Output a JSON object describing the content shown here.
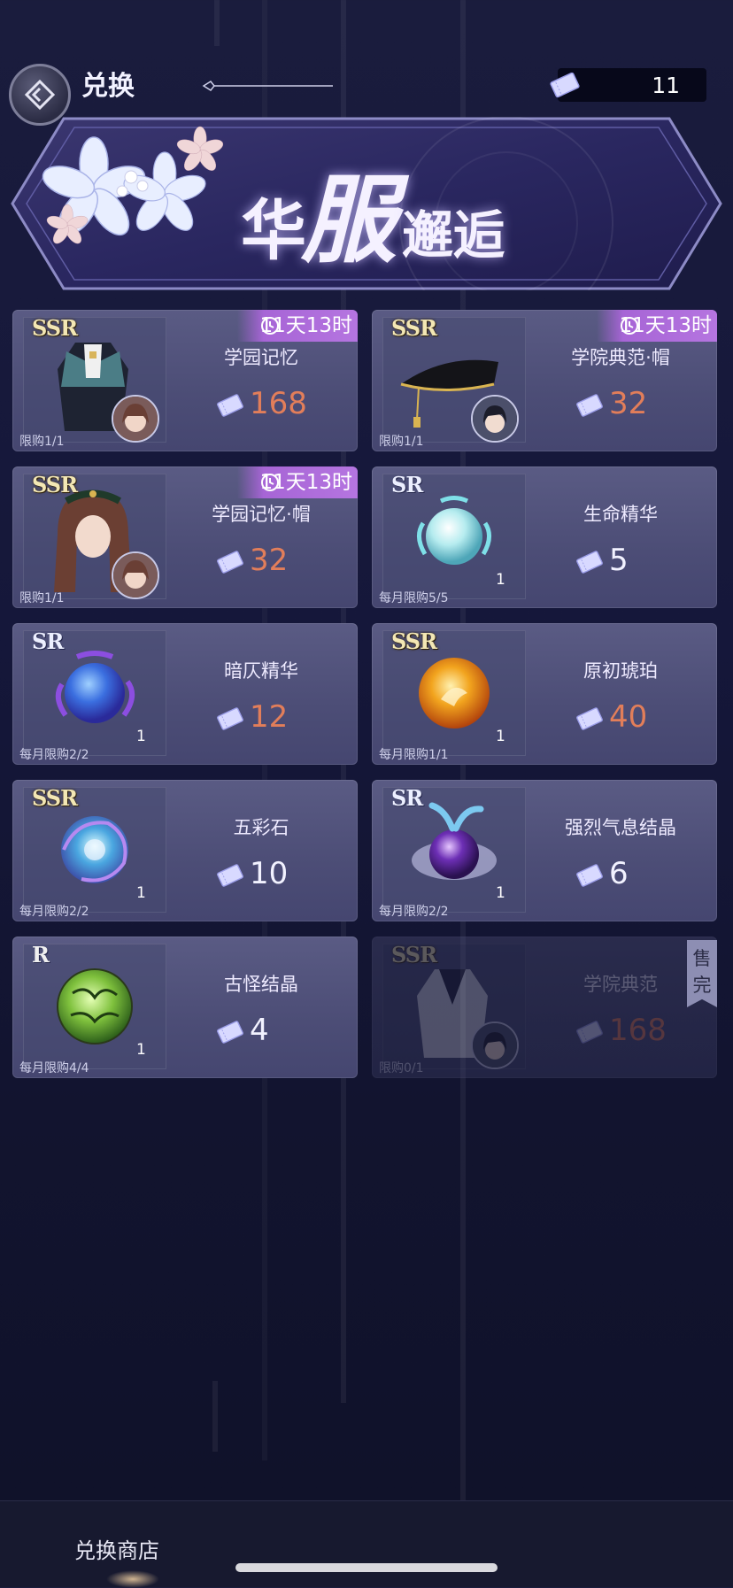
{
  "header": {
    "title": "兑换",
    "currency_amount": "11"
  },
  "banner": {
    "title_1": "华",
    "title_2": "服",
    "title_3": "邂逅"
  },
  "items": [
    {
      "rarity": "SSR",
      "name": "学园记忆",
      "price": "168",
      "limit": "限购1/1",
      "timer": "11天13时",
      "icon": "outfit-icon"
    },
    {
      "rarity": "SSR",
      "name": "学院典范·帽",
      "price": "32",
      "limit": "限购1/1",
      "timer": "11天13时",
      "icon": "hat-icon"
    },
    {
      "rarity": "SSR",
      "name": "学园记忆·帽",
      "price": "32",
      "limit": "限购1/1",
      "timer": "11天13时",
      "icon": "hairpiece-icon"
    },
    {
      "rarity": "SR",
      "name": "生命精华",
      "price": "5",
      "limit": "每月限购5/5",
      "qty": "1",
      "icon": "life-essence-orb-icon"
    },
    {
      "rarity": "SR",
      "name": "暗仄精华",
      "price": "12",
      "limit": "每月限购2/2",
      "qty": "1",
      "icon": "dark-essence-orb-icon"
    },
    {
      "rarity": "SSR",
      "name": "原初琥珀",
      "price": "40",
      "limit": "每月限购1/1",
      "qty": "1",
      "icon": "amber-orb-icon"
    },
    {
      "rarity": "SSR",
      "name": "五彩石",
      "price": "10",
      "limit": "每月限购2/2",
      "qty": "1",
      "icon": "prism-stone-icon"
    },
    {
      "rarity": "SR",
      "name": "强烈气息结晶",
      "price": "6",
      "limit": "每月限购2/2",
      "qty": "1",
      "icon": "aura-crystal-icon"
    },
    {
      "rarity": "R",
      "name": "古怪结晶",
      "price": "4",
      "limit": "每月限购4/4",
      "qty": "1",
      "icon": "odd-crystal-icon"
    },
    {
      "rarity": "SSR",
      "name": "学院典范",
      "price": "168",
      "limit": "限购0/1",
      "sold_out": "售完",
      "icon": "uniform-icon"
    }
  ],
  "bottom_nav": {
    "shop_tab": "兑换商店"
  },
  "colors": {
    "background": "#15173a",
    "card": "#4c4d76",
    "price_orange": "#e27e5a",
    "timer_purple": "#a765d6"
  }
}
